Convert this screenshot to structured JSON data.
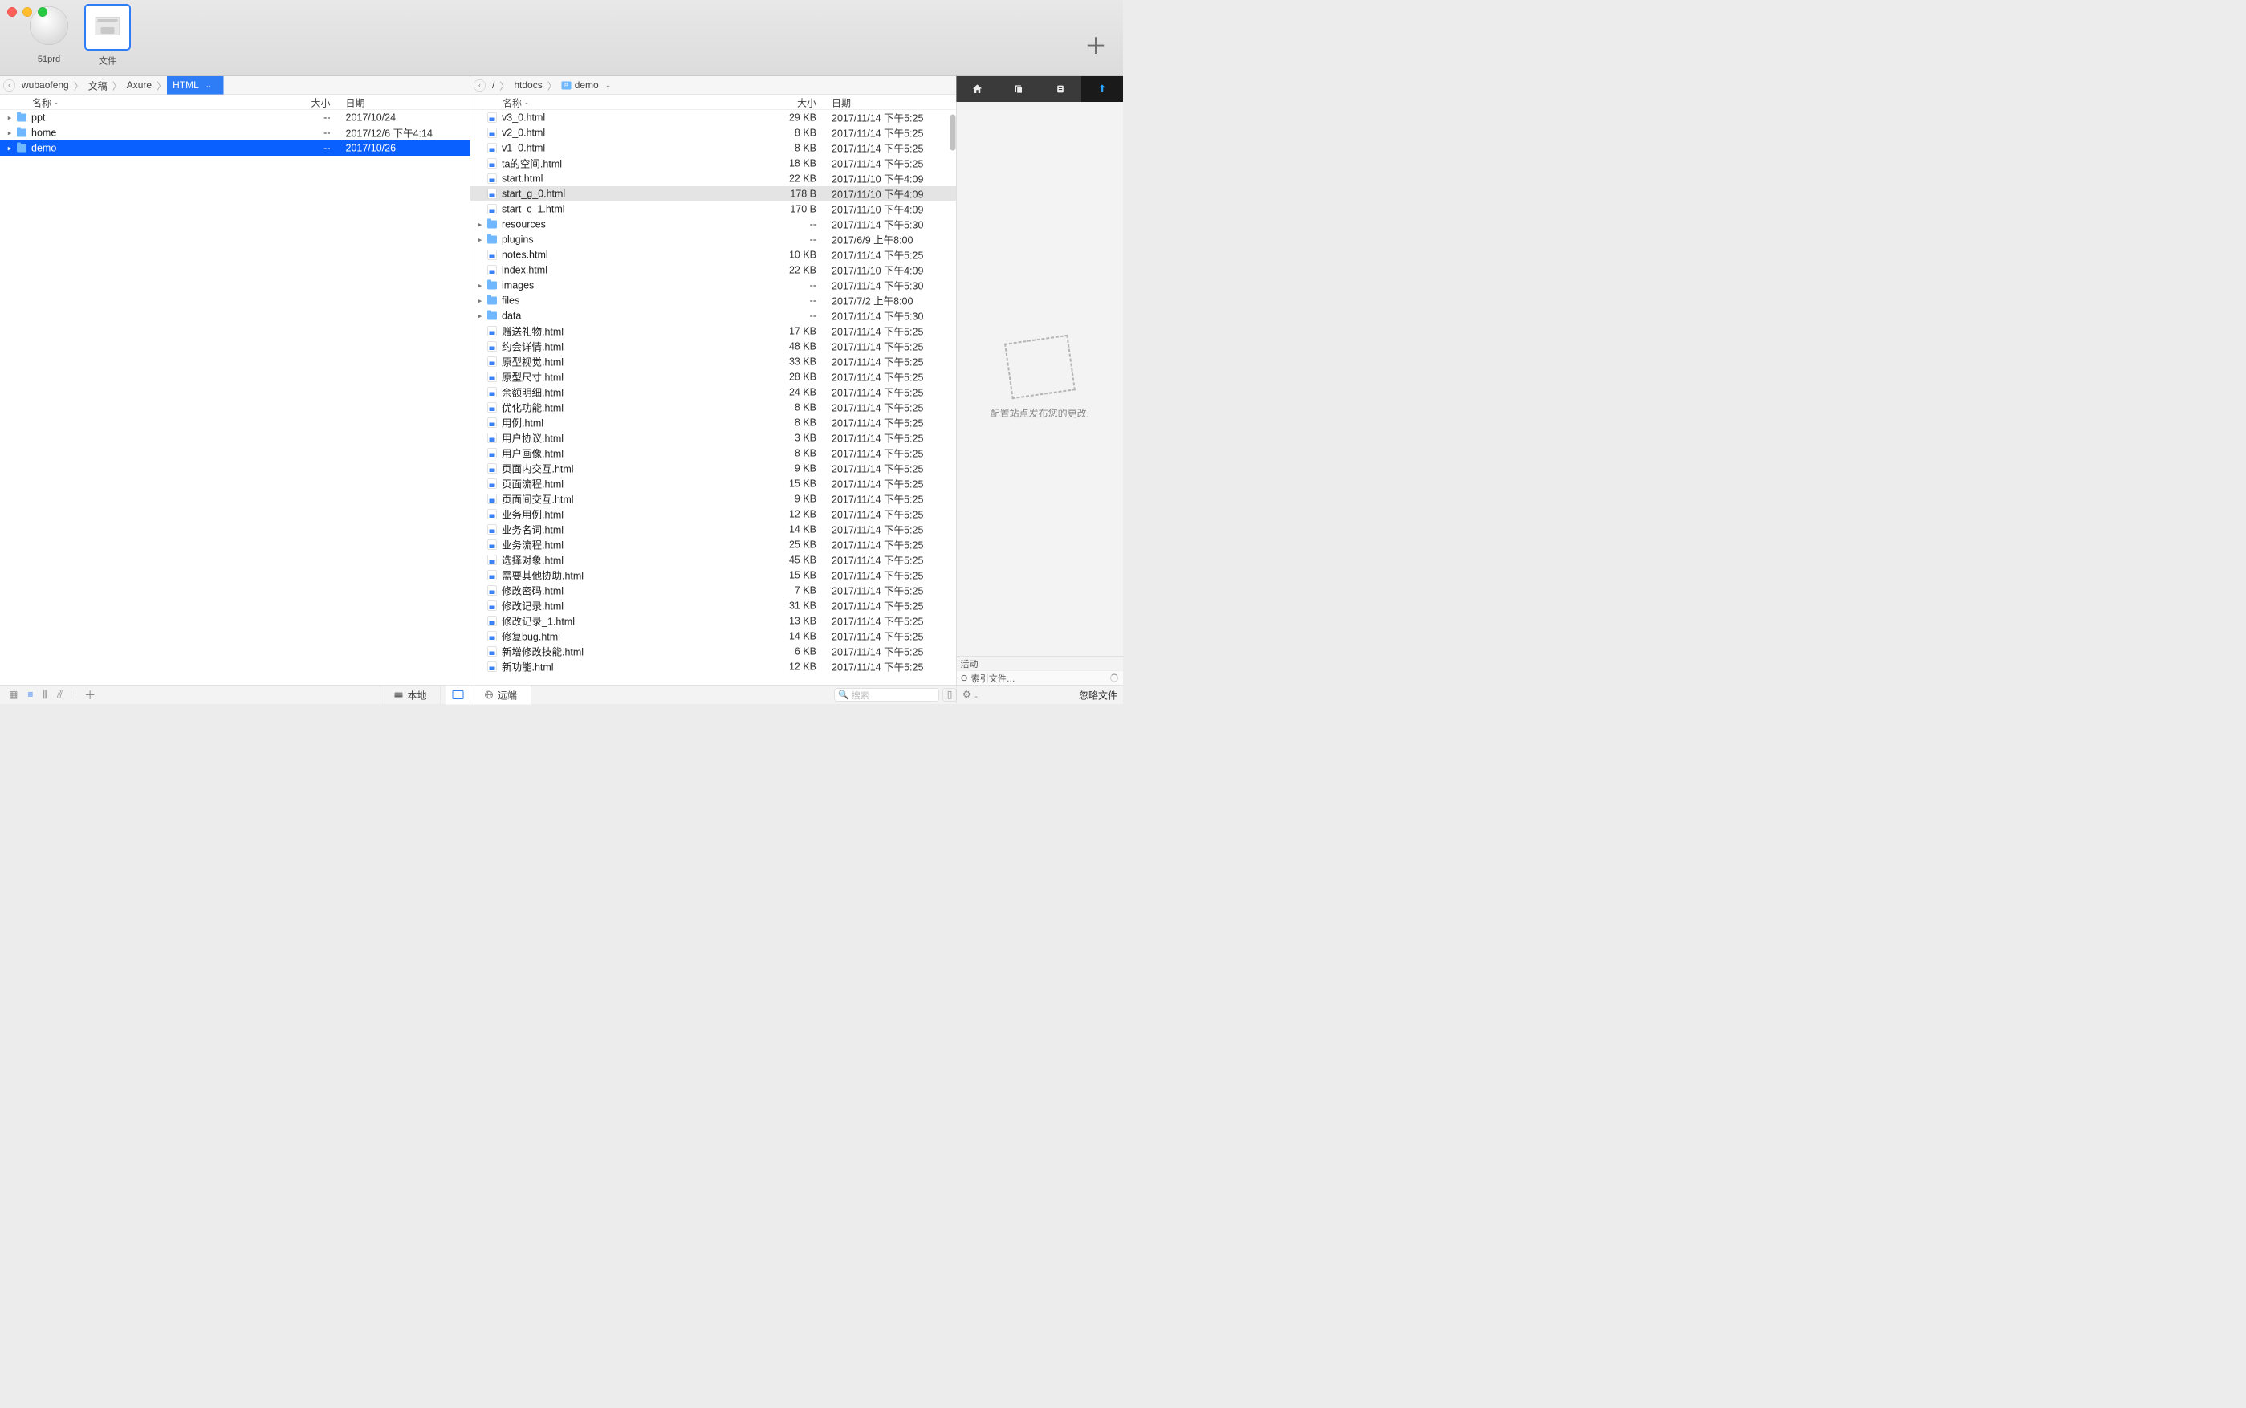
{
  "tabs": [
    {
      "label": "51prd",
      "kind": "globe"
    },
    {
      "label": "文件",
      "kind": "files",
      "selected": true
    }
  ],
  "leftPane": {
    "crumbs": [
      "wubaofeng",
      "文稿",
      "Axure",
      "HTML"
    ],
    "activeCrumb": 3,
    "columns": {
      "name": "名称",
      "size": "大小",
      "date": "日期"
    },
    "rows": [
      {
        "kind": "folder",
        "name": "ppt",
        "size": "--",
        "date": "2017/10/24"
      },
      {
        "kind": "folder",
        "name": "home",
        "size": "--",
        "date": "2017/12/6 下午4:14"
      },
      {
        "kind": "folder",
        "name": "demo",
        "size": "--",
        "date": "2017/10/26",
        "selected": true
      }
    ]
  },
  "rightPane": {
    "crumbs": [
      "/",
      "htdocs",
      "demo"
    ],
    "folderMarker": 2,
    "columns": {
      "name": "名称",
      "size": "大小",
      "date": "日期"
    },
    "rows": [
      {
        "kind": "html",
        "name": "v3_0.html",
        "size": "29 KB",
        "date": "2017/11/14 下午5:25"
      },
      {
        "kind": "html",
        "name": "v2_0.html",
        "size": "8 KB",
        "date": "2017/11/14 下午5:25"
      },
      {
        "kind": "html",
        "name": "v1_0.html",
        "size": "8 KB",
        "date": "2017/11/14 下午5:25"
      },
      {
        "kind": "html",
        "name": "ta的空间.html",
        "size": "18 KB",
        "date": "2017/11/14 下午5:25"
      },
      {
        "kind": "html",
        "name": "start.html",
        "size": "22 KB",
        "date": "2017/11/10 下午4:09"
      },
      {
        "kind": "html",
        "name": "start_g_0.html",
        "size": "178 B",
        "date": "2017/11/10 下午4:09",
        "highlight": true
      },
      {
        "kind": "html",
        "name": "start_c_1.html",
        "size": "170 B",
        "date": "2017/11/10 下午4:09"
      },
      {
        "kind": "folder",
        "name": "resources",
        "size": "--",
        "date": "2017/11/14 下午5:30",
        "expandable": true
      },
      {
        "kind": "folder",
        "name": "plugins",
        "size": "--",
        "date": "2017/6/9 上午8:00",
        "expandable": true
      },
      {
        "kind": "html",
        "name": "notes.html",
        "size": "10 KB",
        "date": "2017/11/14 下午5:25"
      },
      {
        "kind": "html",
        "name": "index.html",
        "size": "22 KB",
        "date": "2017/11/10 下午4:09"
      },
      {
        "kind": "folder",
        "name": "images",
        "size": "--",
        "date": "2017/11/14 下午5:30",
        "expandable": true
      },
      {
        "kind": "folder",
        "name": "files",
        "size": "--",
        "date": "2017/7/2 上午8:00",
        "expandable": true
      },
      {
        "kind": "folder",
        "name": "data",
        "size": "--",
        "date": "2017/11/14 下午5:30",
        "expandable": true
      },
      {
        "kind": "html",
        "name": "赠送礼物.html",
        "size": "17 KB",
        "date": "2017/11/14 下午5:25"
      },
      {
        "kind": "html",
        "name": "约会详情.html",
        "size": "48 KB",
        "date": "2017/11/14 下午5:25"
      },
      {
        "kind": "html",
        "name": "原型视觉.html",
        "size": "33 KB",
        "date": "2017/11/14 下午5:25"
      },
      {
        "kind": "html",
        "name": "原型尺寸.html",
        "size": "28 KB",
        "date": "2017/11/14 下午5:25"
      },
      {
        "kind": "html",
        "name": "余额明细.html",
        "size": "24 KB",
        "date": "2017/11/14 下午5:25"
      },
      {
        "kind": "html",
        "name": "优化功能.html",
        "size": "8 KB",
        "date": "2017/11/14 下午5:25"
      },
      {
        "kind": "html",
        "name": "用例.html",
        "size": "8 KB",
        "date": "2017/11/14 下午5:25"
      },
      {
        "kind": "html",
        "name": "用户协议.html",
        "size": "3 KB",
        "date": "2017/11/14 下午5:25"
      },
      {
        "kind": "html",
        "name": "用户画像.html",
        "size": "8 KB",
        "date": "2017/11/14 下午5:25"
      },
      {
        "kind": "html",
        "name": "页面内交互.html",
        "size": "9 KB",
        "date": "2017/11/14 下午5:25"
      },
      {
        "kind": "html",
        "name": "页面流程.html",
        "size": "15 KB",
        "date": "2017/11/14 下午5:25"
      },
      {
        "kind": "html",
        "name": "页面间交互.html",
        "size": "9 KB",
        "date": "2017/11/14 下午5:25"
      },
      {
        "kind": "html",
        "name": "业务用例.html",
        "size": "12 KB",
        "date": "2017/11/14 下午5:25"
      },
      {
        "kind": "html",
        "name": "业务名词.html",
        "size": "14 KB",
        "date": "2017/11/14 下午5:25"
      },
      {
        "kind": "html",
        "name": "业务流程.html",
        "size": "25 KB",
        "date": "2017/11/14 下午5:25"
      },
      {
        "kind": "html",
        "name": "选择对象.html",
        "size": "45 KB",
        "date": "2017/11/14 下午5:25"
      },
      {
        "kind": "html",
        "name": "需要其他协助.html",
        "size": "15 KB",
        "date": "2017/11/14 下午5:25"
      },
      {
        "kind": "html",
        "name": "修改密码.html",
        "size": "7 KB",
        "date": "2017/11/14 下午5:25"
      },
      {
        "kind": "html",
        "name": "修改记录.html",
        "size": "31 KB",
        "date": "2017/11/14 下午5:25"
      },
      {
        "kind": "html",
        "name": "修改记录_1.html",
        "size": "13 KB",
        "date": "2017/11/14 下午5:25"
      },
      {
        "kind": "html",
        "name": "修复bug.html",
        "size": "14 KB",
        "date": "2017/11/14 下午5:25"
      },
      {
        "kind": "html",
        "name": "新增修改技能.html",
        "size": "6 KB",
        "date": "2017/11/14 下午5:25"
      },
      {
        "kind": "html",
        "name": "新功能.html",
        "size": "12 KB",
        "date": "2017/11/14 下午5:25"
      }
    ]
  },
  "sidebar": {
    "placeholder": "配置站点发布您的更改."
  },
  "bottombar": {
    "local": "本地",
    "remote": "远端",
    "searchPlaceholder": "搜索"
  },
  "activity": {
    "title": "活动",
    "indexing": "索引文件…",
    "ignore": "忽略文件"
  }
}
